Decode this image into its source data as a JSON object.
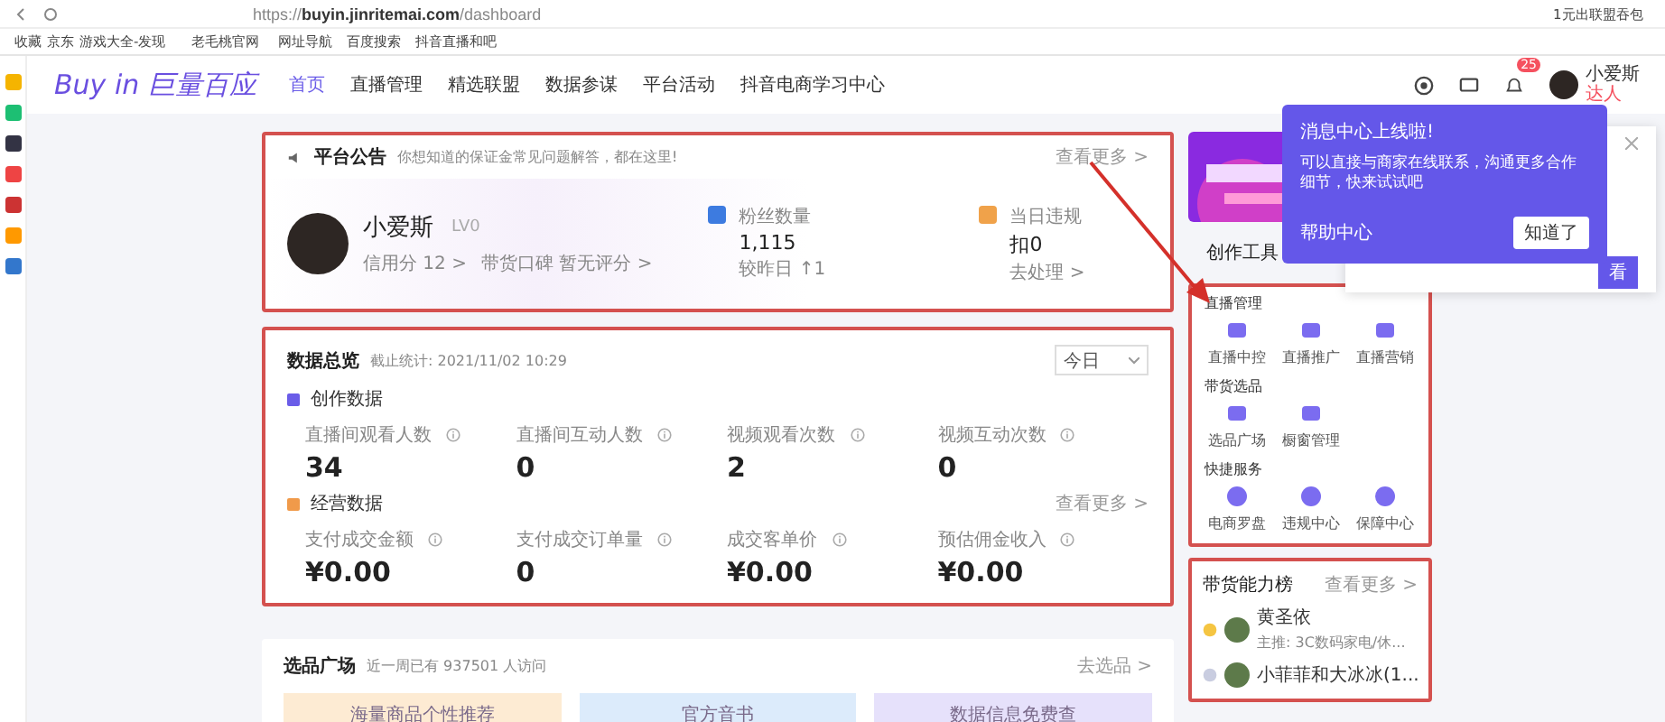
{
  "browser": {
    "url_prefix": "https://",
    "url_host": "buyin.jinritemai.com",
    "url_path": "/dashboard",
    "search_text": "1元出联盟吞包",
    "bookmarks": [
      "收藏",
      "京东",
      "游戏大全-发现",
      "老毛桃官网",
      "网址导航",
      "百度搜索",
      "抖音直播和吧"
    ]
  },
  "header": {
    "logo_latin": "Buy in",
    "logo_cjk": "巨量百应",
    "nav": [
      {
        "label": "首页",
        "selected": true
      },
      {
        "label": "直播管理",
        "selected": false
      },
      {
        "label": "精选联盟",
        "selected": false
      },
      {
        "label": "数据参谋",
        "selected": false
      },
      {
        "label": "平台活动",
        "selected": false
      },
      {
        "label": "抖音电商学习中心",
        "selected": false
      }
    ],
    "notification_count": "25",
    "user_name": "小爱斯",
    "user_badge": "达人"
  },
  "announcement": {
    "title": "平台公告",
    "text": "你想知道的保证金常见问题解答，都在这里!",
    "more": "查看更多 >"
  },
  "profile": {
    "name": "小爱斯",
    "level": "LV0",
    "credit": "信用分 12 >",
    "reputation": "带货口碑 暂无评分 >",
    "stats": [
      {
        "label": "粉丝数量",
        "value": "1,115",
        "sub": "较昨日 ↑1",
        "color": "#3d7be0"
      },
      {
        "label": "当日违规",
        "value": "扣0",
        "sub": "去处理 >",
        "color": "#f0a24a"
      }
    ]
  },
  "overview": {
    "title": "数据总览",
    "updated": "截止统计: 2021/11/02 10:29",
    "period": "今日",
    "sections": [
      {
        "title": "创作数据",
        "color": "#6a5ce8",
        "metrics": [
          {
            "label": "直播间观看人数",
            "value": "34"
          },
          {
            "label": "直播间互动人数",
            "value": "0"
          },
          {
            "label": "视频观看次数",
            "value": "2"
          },
          {
            "label": "视频互动次数",
            "value": "0"
          }
        ]
      },
      {
        "title": "经营数据",
        "color": "#f09a4a",
        "more": "查看更多 >",
        "metrics": [
          {
            "label": "支付成交金额",
            "value": "¥0.00"
          },
          {
            "label": "支付成交订单量",
            "value": "0"
          },
          {
            "label": "成交客单价",
            "value": "¥0.00"
          },
          {
            "label": "预估佣金收入",
            "value": "¥0.00"
          }
        ]
      }
    ]
  },
  "selection": {
    "title": "选品广场",
    "sub": "近一周已有 937501 人访问",
    "more": "去选品 >",
    "cards": [
      {
        "label": "海量商品个性推荐",
        "color": "#fdebd3"
      },
      {
        "label": "官方音书",
        "color": "#dcebfb"
      },
      {
        "label": "数据信息免费查",
        "color": "#e6e1fb"
      }
    ]
  },
  "tools": {
    "title": "创作工具",
    "groups": [
      {
        "title": "直播管理",
        "items": [
          "直播中控",
          "直播推广",
          "直播营销"
        ]
      },
      {
        "title": "带货选品",
        "items": [
          "选品广场",
          "橱窗管理"
        ]
      },
      {
        "title": "快捷服务",
        "items": [
          "电商罗盘",
          "违规中心",
          "保障中心"
        ]
      }
    ]
  },
  "ranking": {
    "title": "带货能力榜",
    "more": "查看更多 >",
    "items": [
      {
        "name": "黄圣依",
        "desc": "主推: 3C数码家电/休...",
        "color": "#f5c542"
      },
      {
        "name": "小菲菲和大冰冰(1...",
        "color": "#c9cde0"
      }
    ]
  },
  "popup": {
    "title": "消息中心上线啦!",
    "body": "可以直接与商家在线联系，沟通更多合作细节，快来试试吧",
    "link": "帮助中心",
    "button": "知道了"
  },
  "behind_card": {
    "button": "看"
  }
}
